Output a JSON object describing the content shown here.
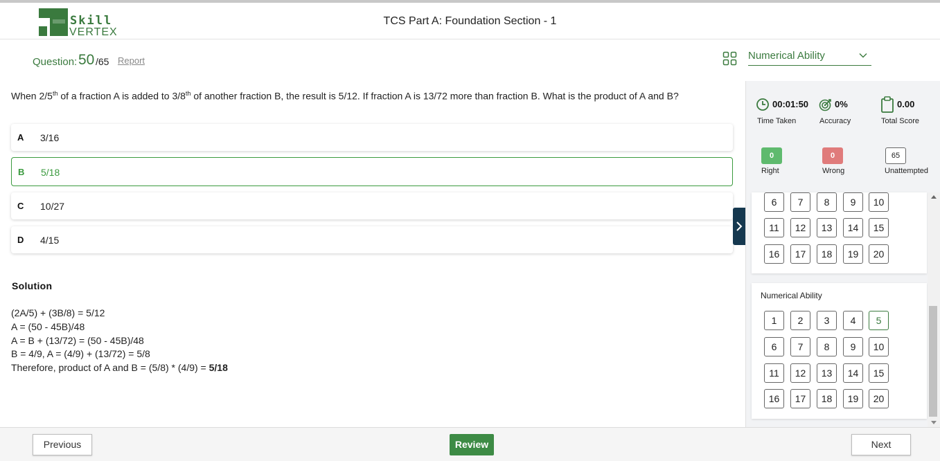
{
  "logo": {
    "line1": "Skill",
    "line2": "VERTEX"
  },
  "header": {
    "title": "TCS Part A: Foundation Section - 1"
  },
  "question_bar": {
    "label": "Question:",
    "current": "50",
    "total": "/65",
    "report": "Report"
  },
  "section_select": {
    "value": "Numerical Ability"
  },
  "question": {
    "part1": "When 2/5",
    "sup1": "th",
    "part2": " of a fraction A is added to 3/8",
    "sup2": "th",
    "part3": " of another fraction B, the result is 5/12. If fraction A is 13/72 more than fraction B. What is the product of A and B?"
  },
  "options": [
    {
      "letter": "A",
      "text": "3/16"
    },
    {
      "letter": "B",
      "text": "5/18"
    },
    {
      "letter": "C",
      "text": "10/27"
    },
    {
      "letter": "D",
      "text": "4/15"
    }
  ],
  "solution": {
    "title": "Solution",
    "lines": [
      "(2A/5) + (3B/8) = 5/12",
      "A = (50 - 45B)/48",
      "A = B + (13/72) = (50 - 45B)/48",
      "B = 4/9, A = (4/9) + (13/72) = 5/8"
    ],
    "final_prefix": "Therefore, product of A and B = (5/8) * (4/9) = ",
    "final_answer": "5/18"
  },
  "stats": {
    "time": {
      "value": "00:01:50",
      "label": "Time Taken"
    },
    "accuracy": {
      "value": "0%",
      "label": "Accuracy"
    },
    "score": {
      "value": "0.00",
      "label": "Total Score"
    }
  },
  "counts": {
    "right": {
      "value": "0",
      "label": "Right"
    },
    "wrong": {
      "value": "0",
      "label": "Wrong"
    },
    "unattempted": {
      "value": "65",
      "label": "Unattempted"
    }
  },
  "panel_top": {
    "rows": [
      [
        "6",
        "7",
        "8",
        "9",
        "10"
      ],
      [
        "11",
        "12",
        "13",
        "14",
        "15"
      ],
      [
        "16",
        "17",
        "18",
        "19",
        "20"
      ]
    ]
  },
  "panel_bottom": {
    "title": "Numerical Ability",
    "rows": [
      [
        "1",
        "2",
        "3",
        "4",
        "5"
      ],
      [
        "6",
        "7",
        "8",
        "9",
        "10"
      ],
      [
        "11",
        "12",
        "13",
        "14",
        "15"
      ],
      [
        "16",
        "17",
        "18",
        "19",
        "20"
      ]
    ]
  },
  "footer": {
    "previous": "Previous",
    "review": "Review",
    "next": "Next"
  },
  "colors": {
    "brand_green": "#3a7a3e",
    "right_green": "#5fba6e",
    "wrong_red": "#e07b7b",
    "nav_dark": "#15384f"
  }
}
